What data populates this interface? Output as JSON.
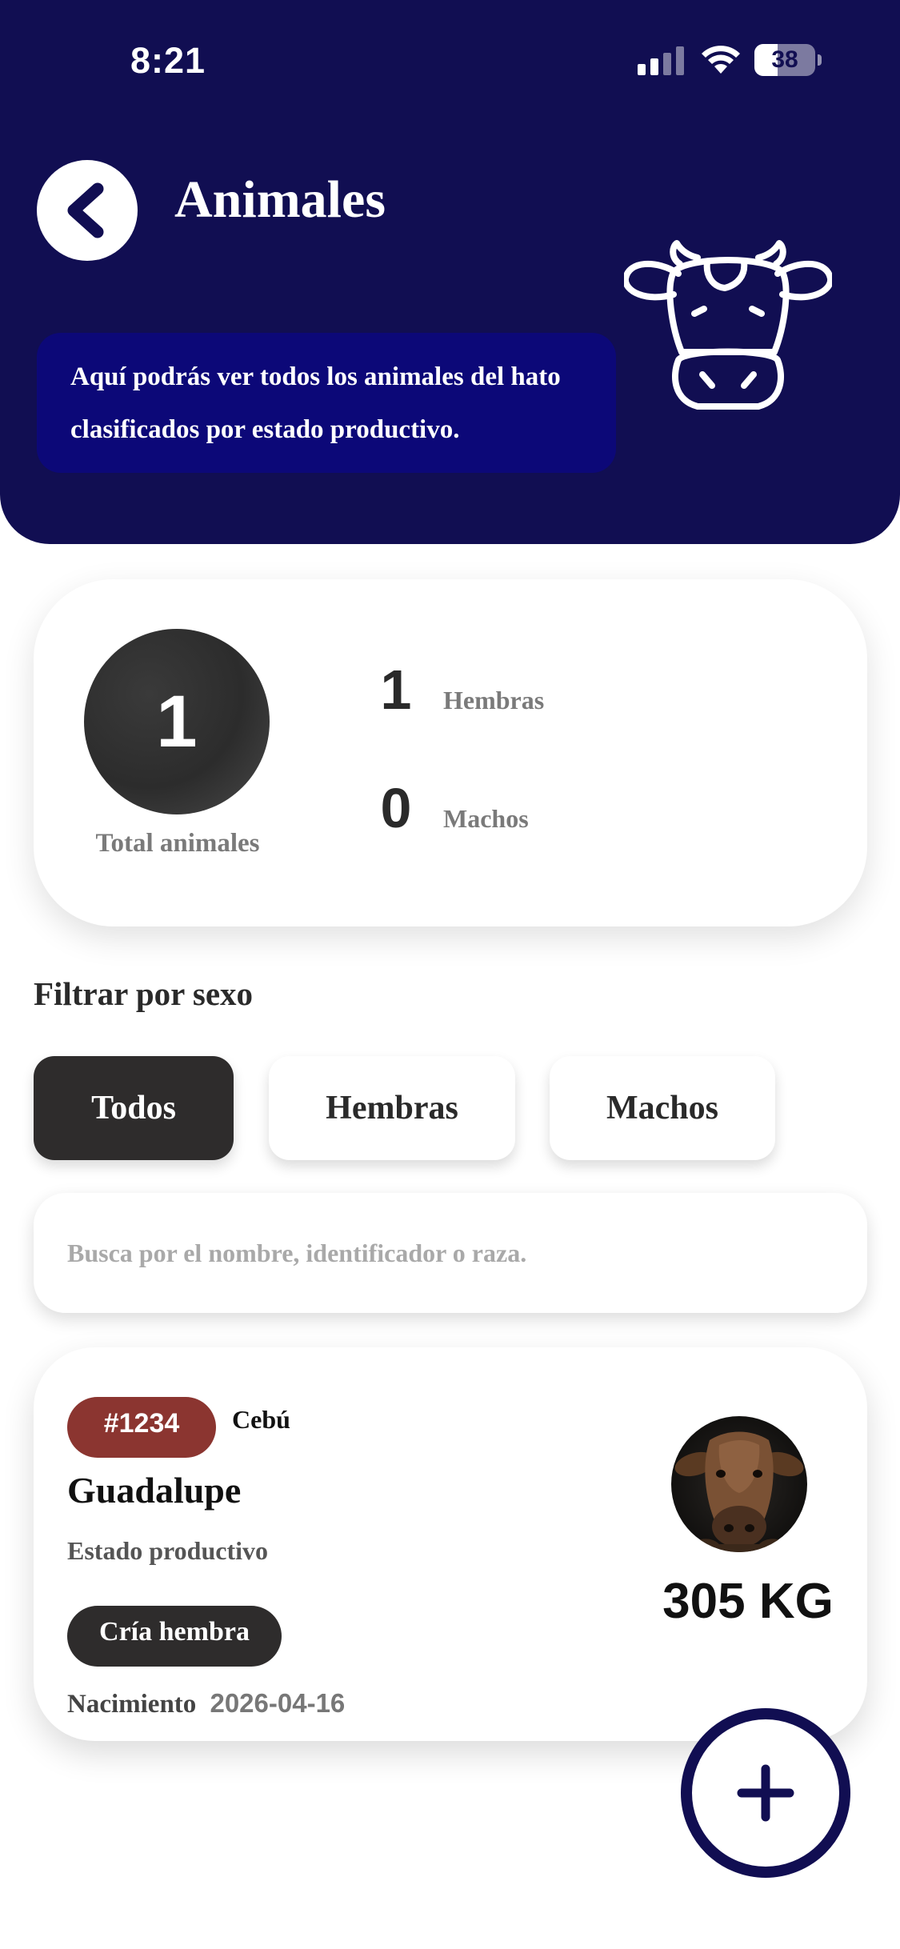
{
  "status_bar": {
    "time": "8:21",
    "battery": "38",
    "battery_level": 0.38
  },
  "header": {
    "title": "Animales",
    "description": "Aquí podrás ver todos los animales del hato clasificados por estado productivo.",
    "icon": "cow-head-icon",
    "background_color": "#110e52",
    "info_box_color": "#0c0878"
  },
  "summary": {
    "total": "1",
    "total_label": "Total animales",
    "hembras_count": "1",
    "hembras_label": "Hembras",
    "machos_count": "0",
    "machos_label": "Machos"
  },
  "filter": {
    "title": "Filtrar por sexo",
    "options": [
      "Todos",
      "Hembras",
      "Machos"
    ],
    "selected": "Todos"
  },
  "search": {
    "placeholder": "Busca por el nombre, identificador o raza.",
    "value": ""
  },
  "animals": [
    {
      "id": "#1234",
      "breed": "Cebú",
      "name": "Guadalupe",
      "estado_label": "Estado productivo",
      "estado": "Cría hembra",
      "birth_label": "Nacimiento",
      "birth_date": "2026-04-16",
      "weight": "305 KG",
      "id_badge_color": "#8b3530"
    }
  ],
  "fab": {
    "icon": "plus-icon"
  }
}
